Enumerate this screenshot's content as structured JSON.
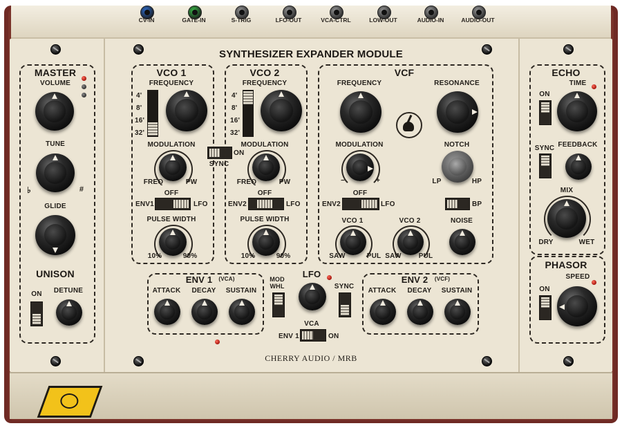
{
  "jacks": [
    {
      "label": "CV-IN",
      "color": "#2f6fd1"
    },
    {
      "label": "GATE-IN",
      "color": "#3bbf4a"
    },
    {
      "label": "S-TRIG",
      "color": ""
    },
    {
      "label": "LFO-OUT",
      "color": ""
    },
    {
      "label": "VCA-CTRL",
      "color": ""
    },
    {
      "label": "LOW-OUT",
      "color": ""
    },
    {
      "label": "AUDIO-IN",
      "color": ""
    },
    {
      "label": "AUDIO-OUT",
      "color": ""
    }
  ],
  "module_title": "SYNTHESIZER EXPANDER MODULE",
  "brand": "CHERRY AUDIO / MRB",
  "master": {
    "title": "MASTER",
    "volume": "VOLUME",
    "tune": "TUNE",
    "flat": "♭",
    "sharp": "#",
    "glide": "GLIDE",
    "unison": "UNISON",
    "on": "ON",
    "detune": "DETUNE"
  },
  "vco1": {
    "title": "VCO 1",
    "frequency": "FREQUENCY",
    "ranges": [
      "4'",
      "8'",
      "16'",
      "32'"
    ],
    "modulation": "MODULATION",
    "freq": "FREQ",
    "pw": "PW",
    "off": "OFF",
    "env": "ENV1",
    "lfo": "LFO",
    "pulse_width": "PULSE WIDTH",
    "pw_min": "10%",
    "pw_max": "90%"
  },
  "vco2": {
    "title": "VCO 2",
    "frequency": "FREQUENCY",
    "ranges": [
      "4'",
      "8'",
      "16'",
      "32'"
    ],
    "modulation": "MODULATION",
    "freq": "FREQ",
    "pw": "PW",
    "off": "OFF",
    "env": "ENV2",
    "lfo": "LFO",
    "pulse_width": "PULSE WIDTH",
    "pw_min": "10%",
    "pw_max": "90%"
  },
  "sync": {
    "label": "SYNC",
    "on": "ON"
  },
  "vcf": {
    "title": "VCF",
    "frequency": "FREQUENCY",
    "resonance": "RESONANCE",
    "modulation": "MODULATION",
    "minus": "−",
    "plus": "+",
    "notch": "NOTCH",
    "lp": "LP",
    "hp": "HP",
    "off": "OFF",
    "env": "ENV2",
    "lfo": "LFO",
    "bp": "BP",
    "vco1": "VCO 1",
    "vco2": "VCO 2",
    "noise": "NOISE",
    "saw": "SAW",
    "pul": "PUL"
  },
  "env1": {
    "title": "ENV 1",
    "sub": "(VCA)",
    "attack": "ATTACK",
    "decay": "DECAY",
    "sustain": "SUSTAIN"
  },
  "env2": {
    "title": "ENV 2",
    "sub": "(VCF)",
    "attack": "ATTACK",
    "decay": "DECAY",
    "sustain": "SUSTAIN"
  },
  "mod_whl": {
    "line1": "MOD",
    "line2": "WHL"
  },
  "lfo": {
    "title": "LFO",
    "sync": "SYNC"
  },
  "vca": {
    "title": "VCA",
    "env1": "ENV 1",
    "on": "ON"
  },
  "echo": {
    "title": "ECHO",
    "time": "TIME",
    "on": "ON",
    "sync": "SYNC",
    "feedback": "FEEDBACK",
    "mix": "MIX",
    "dry": "DRY",
    "wet": "WET"
  },
  "phasor": {
    "title": "PHASOR",
    "speed": "SPEED",
    "on": "ON"
  },
  "colors": {
    "panel": "#ece5d4",
    "chassis": "#6f2a24",
    "ink": "#24201b",
    "led": "#d42a1c",
    "badge": "#f2c21a"
  }
}
